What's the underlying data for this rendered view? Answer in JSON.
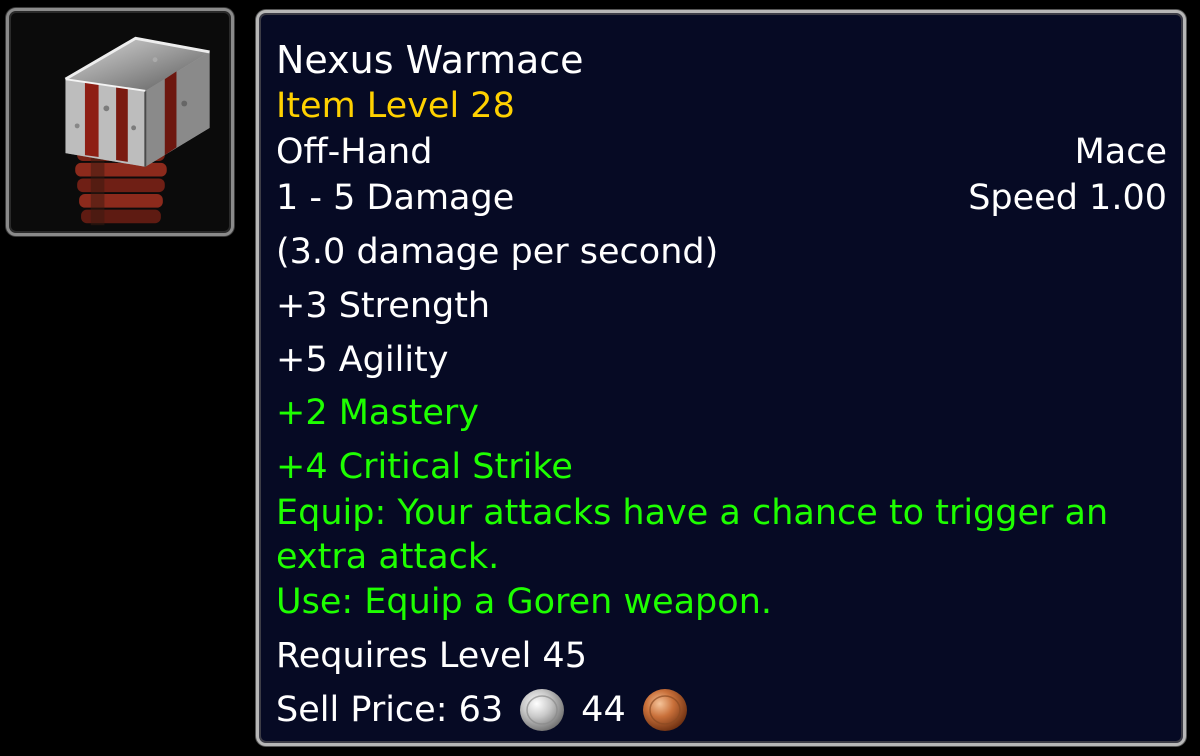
{
  "item": {
    "icon": "mace-icon",
    "name": "Nexus Warmace",
    "item_level": "Item Level 28",
    "slot": "Off-Hand",
    "weapon_type": "Mace",
    "damage": "1 - 5 Damage",
    "speed": "Speed 1.00",
    "dps": "(3.0 damage per second)",
    "stats": {
      "strength": "+3 Strength",
      "agility": "+5 Agility",
      "mastery": "+2 Mastery",
      "critical_strike": "+4 Critical Strike"
    },
    "equip_effect": "Equip: Your attacks have a chance to trigger an extra attack.",
    "use_effect": "Use: Equip a Goren weapon.",
    "requirement": "Requires Level 45",
    "sell_price": {
      "label": "Sell Price: ",
      "silver": "63",
      "copper": "44"
    }
  },
  "colors": {
    "tooltip_bg": "#060a24",
    "border": "#b7b7b7",
    "item_level": "#ffd100",
    "green_stat": "#1eff00",
    "white_text": "#ffffff"
  }
}
